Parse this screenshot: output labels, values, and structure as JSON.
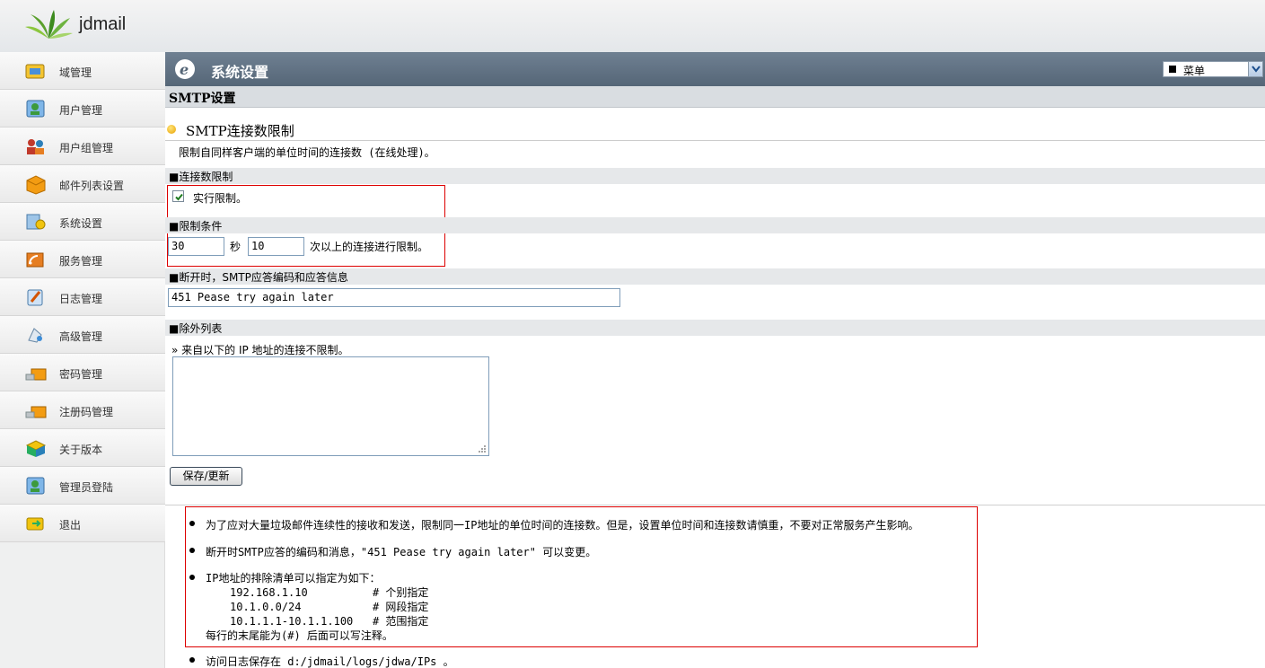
{
  "brand": "jdmail",
  "sidebar": {
    "items": [
      {
        "label": "域管理",
        "icon": "domain-icon"
      },
      {
        "label": "用户管理",
        "icon": "user-icon"
      },
      {
        "label": "用户组管理",
        "icon": "user-group-icon"
      },
      {
        "label": "邮件列表设置",
        "icon": "mail-list-icon"
      },
      {
        "label": "系统设置",
        "icon": "system-settings-icon"
      },
      {
        "label": "服务管理",
        "icon": "service-icon"
      },
      {
        "label": "日志管理",
        "icon": "log-icon"
      },
      {
        "label": "高级管理",
        "icon": "advanced-icon"
      },
      {
        "label": "密码管理",
        "icon": "password-icon"
      },
      {
        "label": "注册码管理",
        "icon": "register-code-icon"
      },
      {
        "label": "关于版本",
        "icon": "about-icon"
      },
      {
        "label": "管理员登陆",
        "icon": "admin-login-icon"
      },
      {
        "label": "退出",
        "icon": "logout-icon"
      }
    ]
  },
  "title_bar": {
    "title": "系统设置",
    "menu_select": "菜单"
  },
  "section": {
    "title": "SMTP设置"
  },
  "heading": {
    "title": "SMTP连接数限制",
    "description": "限制自同样客户端的单位时间的连接数 (在线处理)。"
  },
  "limit": {
    "header": "■连接数限制",
    "enable_label": "实行限制。",
    "enabled": true,
    "condition_header": "■限制条件",
    "seconds_value": "30",
    "seconds_unit": "秒",
    "count_value": "10",
    "count_suffix": "次以上的连接进行限制。"
  },
  "disconnect": {
    "header": "■断开时，SMTP应答编码和应答信息",
    "value": "451 Pease try again later"
  },
  "exclusion": {
    "header": "■除外列表",
    "description": "» 来自以下的 IP 地址的连接不限制。",
    "value": ""
  },
  "save_button": "保存/更新",
  "notes": {
    "note1": "为了应对大量垃圾邮件连续性的接收和发送，限制同一IP地址的单位时间的连接数。但是，设置单位时间和连接数请慎重，不要对正常服务产生影响。",
    "note2": "断开时SMTP应答的编码和消息，\"451 Pease try again later\" 可以变更。",
    "note3_title": "IP地址的排除清单可以指定为如下：",
    "ex1": "192.168.1.10          # 个别指定",
    "ex2": "10.1.0.0/24           # 网段指定",
    "ex3": "10.1.1.1-10.1.1.100   # 范围指定",
    "note3_tail": "每行的末尾能为(#) 后面可以写注释。",
    "note4": "访问日志保存在 d:/jdmail/logs/jdwa/IPs 。"
  },
  "colors": {
    "title_bar": "#5f7083",
    "highlight_border": "#dd0000"
  }
}
